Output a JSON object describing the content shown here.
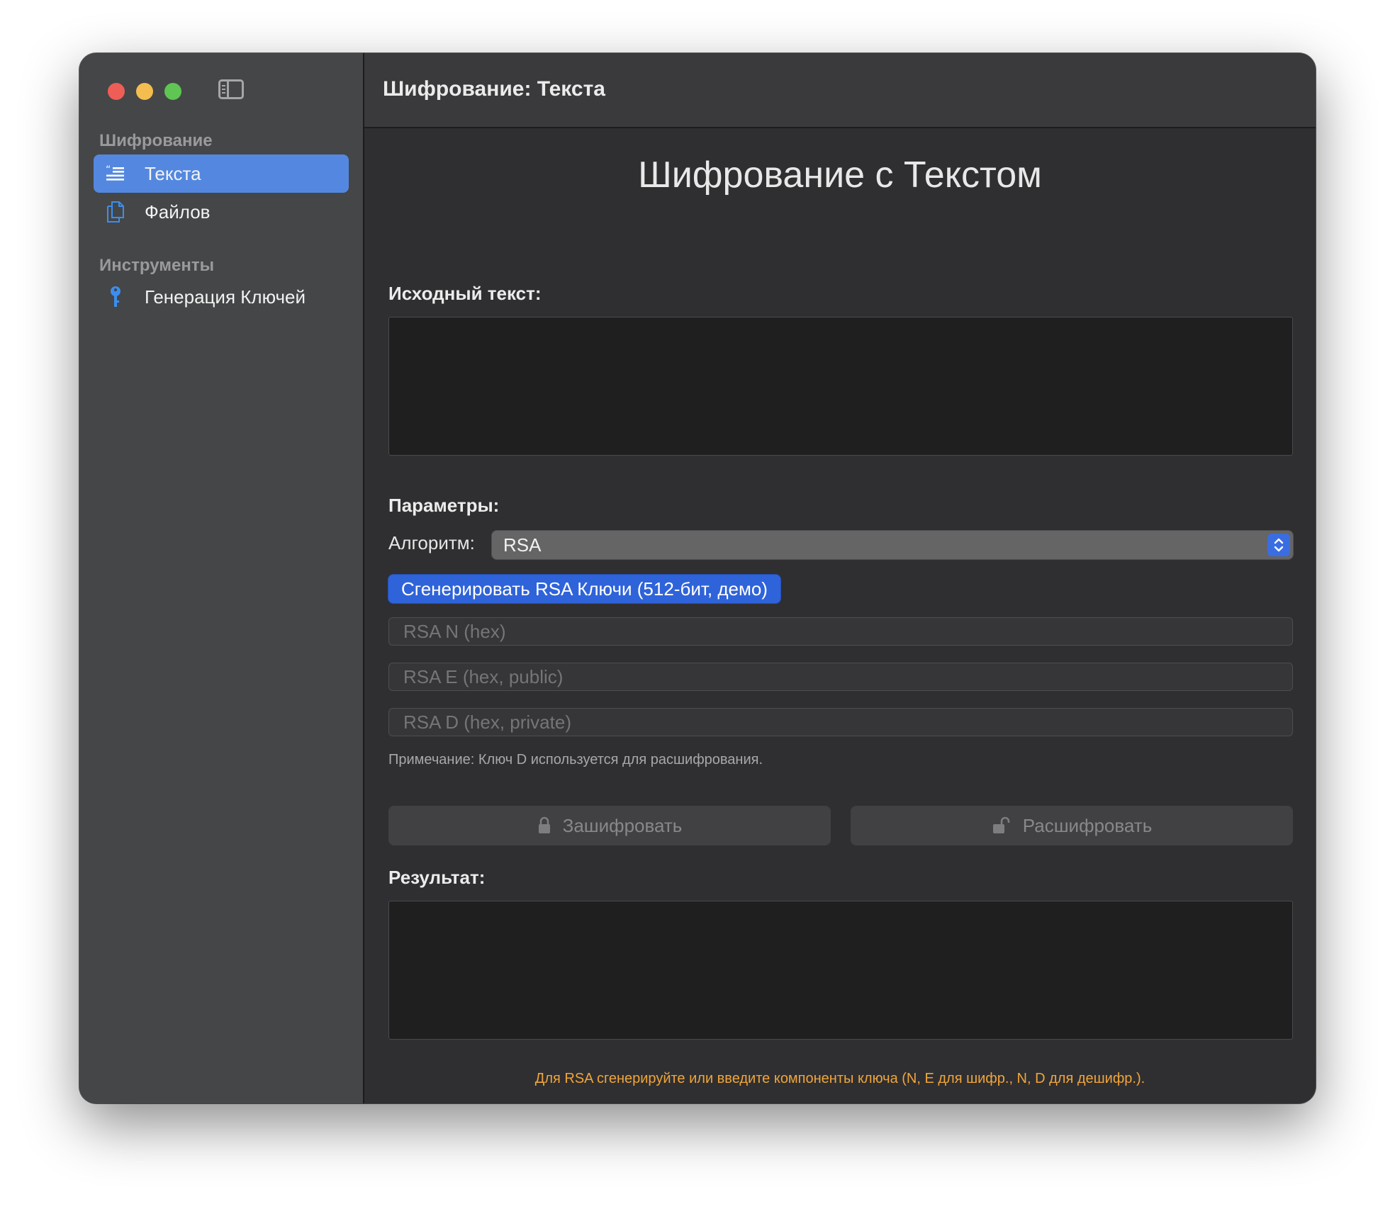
{
  "window": {
    "title": "Шифрование: Текста"
  },
  "sidebar": {
    "sections": [
      {
        "header": "Шифрование",
        "items": [
          {
            "label": "Текста",
            "icon": "text-quote-icon",
            "selected": true
          },
          {
            "label": "Файлов",
            "icon": "documents-icon",
            "selected": false
          }
        ]
      },
      {
        "header": "Инструменты",
        "items": [
          {
            "label": "Генерация Ключей",
            "icon": "key-icon",
            "selected": false
          }
        ]
      }
    ]
  },
  "main": {
    "page_title": "Шифрование с Текстом",
    "source_label": "Исходный текст:",
    "source_value": "",
    "params_label": "Параметры:",
    "algorithm_label": "Алгоритм:",
    "algorithm_value": "RSA",
    "generate_button": "Сгенерировать RSA Ключи (512-бит, демо)",
    "fields": {
      "n_placeholder": "RSA N (hex)",
      "e_placeholder": "RSA E (hex, public)",
      "d_placeholder": "RSA D (hex, private)"
    },
    "note": "Примечание: Ключ D используется для расшифрования.",
    "encrypt_button": "Зашифровать",
    "decrypt_button": "Расшифровать",
    "result_label": "Результат:",
    "result_value": "",
    "hint": "Для RSA сгенерируйте или введите компоненты ключа (N, E для шифр., N, D для дешифр.)."
  },
  "colors": {
    "accent": "#5488e0",
    "button_blue": "#2f63d9",
    "hint_orange": "#f0a53a",
    "key_icon_blue": "#3b8ef0"
  }
}
